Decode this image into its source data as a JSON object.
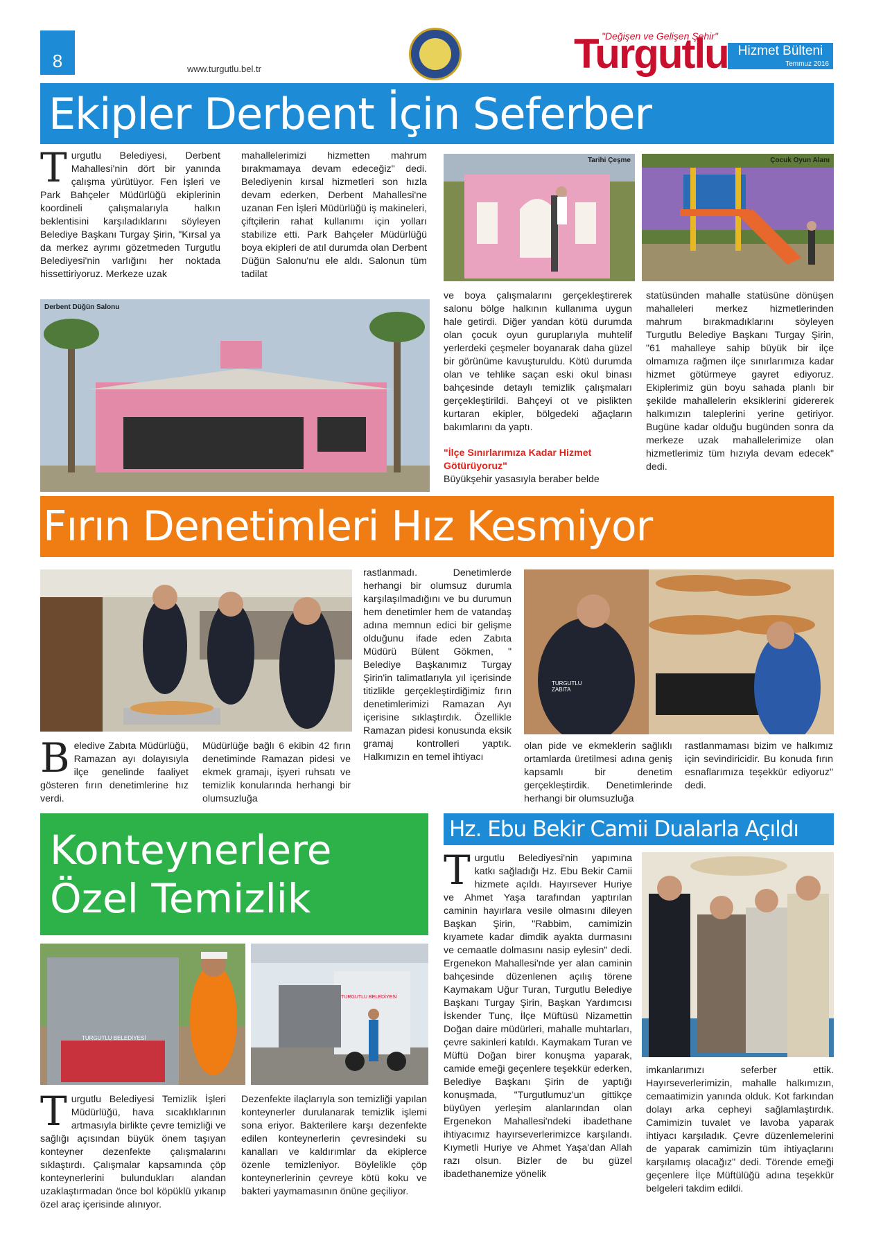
{
  "header": {
    "page_number": "8",
    "url": "www.turgutlu.bel.tr",
    "brand_tagline": "\"Değişen ve Gelişen Şehir\"",
    "brand_name": "Turgutlu",
    "bulletin_title": "Hizmet Bülteni",
    "bulletin_date": "Temmuz 2016"
  },
  "colors": {
    "blue": "#1e8bd6",
    "orange": "#f07d13",
    "green": "#2db24a",
    "red": "#c8102e"
  },
  "article1": {
    "headline": "Ekipler Derbent İçin Seferber",
    "drop_letter": "T",
    "col1": "urgutlu Belediyesi, Derbent Mahallesi'nin dört bir yanında çalışma yürütüyor. Fen İşleri ve Park Bahçeler Müdürlüğü ekiplerinin koordineli çalışmalarıyla halkın beklentisini karşıladıklarını söyleyen Belediye Başkanı Turgay Şirin, \"Kırsal ya da merkez ayrımı gözetmeden Turgutlu Belediyesi'nin varlığını her noktada hissettiriyoruz. Merkeze uzak",
    "col2": "mahallelerimizi hizmetten mahrum bırakmamaya devam edeceğiz\" dedi. Belediyenin kırsal hizmetleri son hızla devam ederken, Derbent Mahallesi'ne uzanan Fen İşleri Müdürlüğü iş makineleri, çiftçilerin rahat kullanımı için yolları stabilize etti. Park Bahçeler Müdürlüğü boya ekipleri de atıl durumda olan Derbent Düğün Salonu'nu ele aldı. Salonun tüm tadilat",
    "col3": "ve boya çalışmalarını gerçekleştirerek salonu bölge halkının kullanıma uygun hale getirdi. Diğer yandan kötü durumda olan çocuk oyun guruplarıyla muhtelif yerlerdeki çeşmeler boyanarak daha güzel bir görünüme kavuşturuldu. Kötü durumda olan ve tehlike saçan eski okul binası bahçesinde detaylı temizlik çalışmaları gerçekleştirildi. Bahçeyi ot ve pislikten kurtaran ekipler, bölgedeki ağaçların bakımlarını da yaptı.",
    "subhead": "\"İlçe Sınırlarımıza Kadar Hizmet Götürüyoruz\"",
    "col3b": "Büyükşehir yasasıyla beraber belde",
    "col4": "statüsünden mahalle statüsüne dönüşen mahalleleri merkez hizmetlerinden mahrum bırakmadıklarını söyleyen Turgutlu Belediye Başkanı Turgay Şirin, \"61 mahalleye sahip büyük bir ilçe olmamıza rağmen ilçe sınırlarımıza kadar hizmet götürmeye gayret ediyoruz. Ekiplerimiz gün boyu sahada planlı bir şekilde mahallelerin eksiklerini gidererek halkımızın taleplerini yerine getiriyor. Bugüne kadar olduğu bugünden sonra da merkeze uzak mahallelerimize olan hizmetlerimiz tüm hızıyla devam edecek\" dedi.",
    "captions": {
      "hall": "Derbent Düğün Salonu",
      "fountain": "Tarihi Çeşme",
      "playground": "Çocuk Oyun Alanı"
    }
  },
  "article2": {
    "headline": "Fırın Denetimleri Hız Kesmiyor",
    "drop_letter": "B",
    "col1": "eledive Zabıta Müdürlüğü, Ramazan ayı dolayısıyla ilçe genelinde faaliyet gösteren fırın denetimlerine hız verdi.",
    "col2": "Müdürlüğe bağlı 6 ekibin 42 fırın denetiminde Ramazan pidesi ve ekmek gramajı, işyeri ruhsatı ve temizlik konularında herhangi bir olumsuzluğa",
    "col3": "rastlanmadı. Denetimlerde herhangi bir olumsuz durumla karşılaşılmadığını ve bu durumun hem denetimler hem de vatandaş adına memnun edici bir gelişme olduğunu ifade eden Zabıta Müdürü Bülent Gökmen, \" Belediye Başkanımız Turgay Şirin'in talimatlarıyla yıl içerisinde titizlikle gerçekleştirdiğimiz fırın denetimlerimizi Ramazan Ayı içerisine sıklaştırdık. Özellikle Ramazan pidesi konusunda eksik gramaj kontrolleri yaptık. Halkımızın en temel ihtiyacı",
    "col4": "olan pide ve ekmeklerin sağlıklı ortamlarda üretilmesi adına geniş kapsamlı bir denetim gerçekleştirdik. Denetimlerinde herhangi bir olumsuzluğa",
    "col5": "rastlanmaması bizim ve halkımız için sevindiricidir. Bu konuda fırın esnaflarımıza teşekkür ediyoruz\" dedi."
  },
  "article3": {
    "headline_line1": "Konteynerlere",
    "headline_line2": "Özel Temizlik",
    "drop_letter": "T",
    "col1": "urgutlu Belediyesi Temizlik İşleri Müdürlüğü, hava sıcaklıklarının artmasıyla birlikte çevre temizliği ve sağlığı açısından büyük önem taşıyan konteyner dezenfekte çalışmalarını sıklaştırdı. Çalışmalar kapsamında çöp konteynerlerini bulundukları alandan uzaklaştırmadan önce bol köpüklü yıkanıp özel araç içerisinde alınıyor.",
    "col2": "Dezenfekte ilaçlarıyla son temizliği yapılan konteynerler durulanarak temizlik işlemi sona eriyor. Bakterilere karşı dezenfekte edilen konteynerlerin çevresindeki su kanalları ve kaldırımlar da ekiplerce özenle temizleniyor. Böylelikle çöp konteynerlerinin çevreye kötü koku ve bakteri yaymamasının önüne geçiliyor."
  },
  "article4": {
    "headline": "Hz. Ebu Bekir Camii Dualarla Açıldı",
    "drop_letter": "T",
    "col1": "urgutlu Belediyesi'nin yapımına katkı sağladığı Hz. Ebu Bekir Camii hizmete açıldı. Hayırsever Huriye ve Ahmet Yaşa tarafından yaptırılan caminin hayırlara vesile olmasını dileyen Başkan Şirin, \"Rabbim, camimizin kıyamete kadar dimdik ayakta durmasını ve cemaatle dolmasını nasip eylesin\" dedi. Ergenekon Mahallesi'nde yer alan caminin bahçesinde düzenlenen açılış törene Kaymakam Uğur Turan, Turgutlu Belediye Başkanı Turgay Şirin, Başkan Yardımcısı İskender Tunç, İlçe Müftüsü Nizamettin Doğan daire müdürleri, mahalle muhtarları, çevre sakinleri katıldı. Kaymakam Turan ve Müftü Doğan birer konuşma yaparak, camide emeği geçenlere teşekkür ederken, Belediye Başkanı Şirin de yaptığı konuşmada, \"Turgutlumuz'un gittikçe büyüyen yerleşim alanlarından olan Ergenekon Mahallesi'ndeki ibadethane ihtiyacımız hayırseverlerimizce karşılandı. Kıymetli Huriye ve Ahmet Yaşa'dan Allah razı olsun. Bizler de bu güzel ibadethanemize yönelik",
    "col2": "imkanlarımızı seferber ettik. Hayırseverlerimizin, mahalle halkımızın, cemaatimizin yanında olduk. Kot farkından dolayı arka cepheyi sağlamlaştırdık. Camimizin tuvalet ve lavoba yaparak ihtiyacı karşıladık. Çevre düzenlemelerini de yaparak camimizin tüm ihtiyaçlarını karşılamış olacağız\" dedi. Törende emeği geçenlere İlçe Müftülüğü adına teşekkür belgeleri takdim edildi."
  },
  "photo_labels": {
    "truck_brand": "TURGUTLU BELEDİYESİ",
    "container_brand": "TURGUTLU BELEDİYESİ",
    "zabita": "TURGUTLU ZABITA"
  }
}
